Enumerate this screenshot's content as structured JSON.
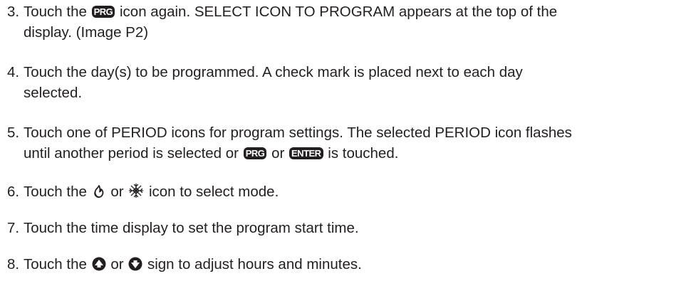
{
  "steps": [
    {
      "number": "3.",
      "line1_a": "Touch the",
      "icon1": "PRG",
      "line1_b": "icon again. SELECT ICON TO PROGRAM appears at the top of the",
      "line2": "display. (Image P2)"
    },
    {
      "number": "4.",
      "line1": "Touch the day(s) to be programmed. A check mark is placed next to each day",
      "line2": "selected."
    },
    {
      "number": "5.",
      "line1": "Touch one of PERIOD icons for program settings. The selected PERIOD icon flashes",
      "line2_a": "until another period is selected or",
      "icon1": "PRG",
      "line2_b": "or",
      "icon2": "ENTER",
      "line2_c": "is touched."
    },
    {
      "number": "6.",
      "text_a": "Touch the",
      "icon_heat": "heat-mode-icon",
      "text_b": "or",
      "icon_cool": "cool-mode-snowflake-icon",
      "text_c": "icon to select mode."
    },
    {
      "number": "7.",
      "text": "Touch the time display to set the program start time."
    },
    {
      "number": "8.",
      "text_a": "Touch the",
      "icon_up": "up-arrow-icon",
      "text_b": "or",
      "icon_down": "down-arrow-icon",
      "text_c": "sign to adjust hours and minutes."
    }
  ]
}
